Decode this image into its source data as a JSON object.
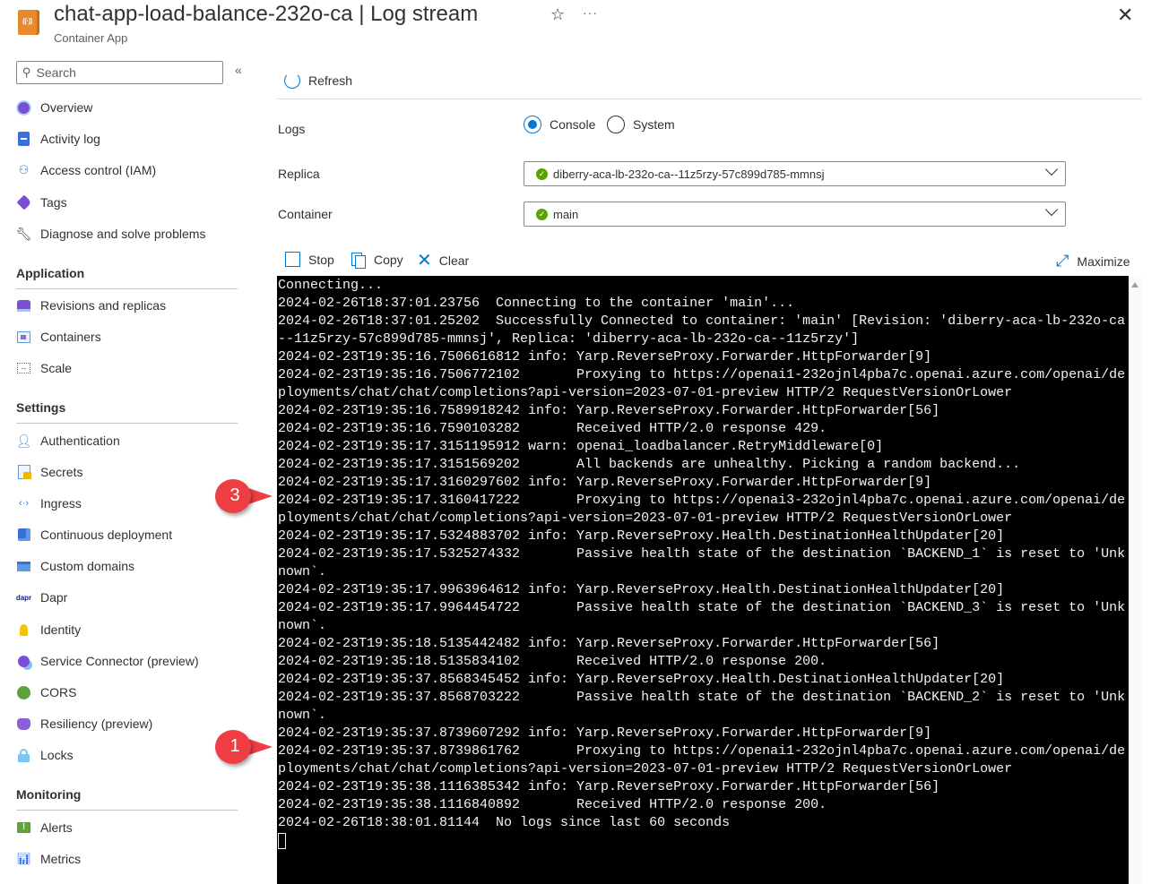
{
  "header": {
    "app_icon": "container-app-icon",
    "title": "chat-app-load-balance-232o-ca | Log stream",
    "subtitle": "Container App",
    "favorite_icon": "star-icon",
    "more_icon": "ellipsis-icon",
    "close_icon": "close-icon"
  },
  "sidebar": {
    "search_placeholder": "Search",
    "collapse_label": "«",
    "top_items": [
      {
        "label": "Overview",
        "icon": "overview-icon"
      },
      {
        "label": "Activity log",
        "icon": "activity-log-icon"
      },
      {
        "label": "Access control (IAM)",
        "icon": "iam-icon"
      },
      {
        "label": "Tags",
        "icon": "tag-icon"
      },
      {
        "label": "Diagnose and solve problems",
        "icon": "wrench-icon"
      }
    ],
    "sections": [
      {
        "title": "Application",
        "items": [
          {
            "label": "Revisions and replicas",
            "icon": "revisions-icon"
          },
          {
            "label": "Containers",
            "icon": "containers-icon"
          },
          {
            "label": "Scale",
            "icon": "scale-icon"
          }
        ]
      },
      {
        "title": "Settings",
        "items": [
          {
            "label": "Authentication",
            "icon": "authentication-icon"
          },
          {
            "label": "Secrets",
            "icon": "secrets-icon"
          },
          {
            "label": "Ingress",
            "icon": "ingress-icon"
          },
          {
            "label": "Continuous deployment",
            "icon": "continuous-deployment-icon"
          },
          {
            "label": "Custom domains",
            "icon": "custom-domains-icon"
          },
          {
            "label": "Dapr",
            "icon": "dapr-icon"
          },
          {
            "label": "Identity",
            "icon": "identity-icon"
          },
          {
            "label": "Service Connector (preview)",
            "icon": "service-connector-icon"
          },
          {
            "label": "CORS",
            "icon": "cors-icon"
          },
          {
            "label": "Resiliency (preview)",
            "icon": "resiliency-icon"
          },
          {
            "label": "Locks",
            "icon": "lock-icon"
          }
        ]
      },
      {
        "title": "Monitoring",
        "items": [
          {
            "label": "Alerts",
            "icon": "alerts-icon"
          },
          {
            "label": "Metrics",
            "icon": "metrics-icon"
          }
        ]
      }
    ]
  },
  "toolbar": {
    "refresh_label": "Refresh",
    "stop_label": "Stop",
    "copy_label": "Copy",
    "clear_label": "Clear",
    "maximize_label": "Maximize"
  },
  "form": {
    "logs_label": "Logs",
    "log_types": [
      {
        "label": "Console",
        "selected": true
      },
      {
        "label": "System",
        "selected": false
      }
    ],
    "replica_label": "Replica",
    "replica_value": "diberry-aca-lb-232o-ca--11z5rzy-57c899d785-mmnsj",
    "container_label": "Container",
    "container_value": "main"
  },
  "console": {
    "lines": [
      "Connecting...",
      "2024-02-26T18:37:01.23756  Connecting to the container 'main'...",
      "2024-02-26T18:37:01.25202  Successfully Connected to container: 'main' [Revision: 'diberry-aca-lb-232o-ca",
      "--11z5rzy-57c899d785-mmnsj', Replica: 'diberry-aca-lb-232o-ca--11z5rzy']",
      "2024-02-23T19:35:16.7506616812 info: Yarp.ReverseProxy.Forwarder.HttpForwarder[9]",
      "2024-02-23T19:35:16.7506772102       Proxying to https://openai1-232ojnl4pba7c.openai.azure.com/openai/de",
      "ployments/chat/chat/completions?api-version=2023-07-01-preview HTTP/2 RequestVersionOrLower",
      "2024-02-23T19:35:16.7589918242 info: Yarp.ReverseProxy.Forwarder.HttpForwarder[56]",
      "2024-02-23T19:35:16.7590103282       Received HTTP/2.0 response 429.",
      "2024-02-23T19:35:17.3151195912 warn: openai_loadbalancer.RetryMiddleware[0]",
      "2024-02-23T19:35:17.3151569202       All backends are unhealthy. Picking a random backend...",
      "2024-02-23T19:35:17.3160297602 info: Yarp.ReverseProxy.Forwarder.HttpForwarder[9]",
      "2024-02-23T19:35:17.3160417222       Proxying to https://openai3-232ojnl4pba7c.openai.azure.com/openai/de",
      "ployments/chat/chat/completions?api-version=2023-07-01-preview HTTP/2 RequestVersionOrLower",
      "2024-02-23T19:35:17.5324883702 info: Yarp.ReverseProxy.Health.DestinationHealthUpdater[20]",
      "2024-02-23T19:35:17.5325274332       Passive health state of the destination `BACKEND_1` is reset to 'Unk",
      "nown`.",
      "2024-02-23T19:35:17.9963964612 info: Yarp.ReverseProxy.Health.DestinationHealthUpdater[20]",
      "2024-02-23T19:35:17.9964454722       Passive health state of the destination `BACKEND_3` is reset to 'Unk",
      "nown`.",
      "2024-02-23T19:35:18.5135442482 info: Yarp.ReverseProxy.Forwarder.HttpForwarder[56]",
      "2024-02-23T19:35:18.5135834102       Received HTTP/2.0 response 200.",
      "2024-02-23T19:35:37.8568345452 info: Yarp.ReverseProxy.Health.DestinationHealthUpdater[20]",
      "2024-02-23T19:35:37.8568703222       Passive health state of the destination `BACKEND_2` is reset to 'Unk",
      "nown`.",
      "2024-02-23T19:35:37.8739607292 info: Yarp.ReverseProxy.Forwarder.HttpForwarder[9]",
      "2024-02-23T19:35:37.8739861762       Proxying to https://openai1-232ojnl4pba7c.openai.azure.com/openai/de",
      "ployments/chat/chat/completions?api-version=2023-07-01-preview HTTP/2 RequestVersionOrLower",
      "2024-02-23T19:35:38.1116385342 info: Yarp.ReverseProxy.Forwarder.HttpForwarder[56]",
      "2024-02-23T19:35:38.1116840892       Received HTTP/2.0 response 200.",
      "2024-02-26T18:38:01.81144  No logs since last 60 seconds"
    ]
  },
  "callouts": [
    {
      "number": "3",
      "color": "#ee3e44"
    },
    {
      "number": "1",
      "color": "#ee3e44"
    }
  ]
}
